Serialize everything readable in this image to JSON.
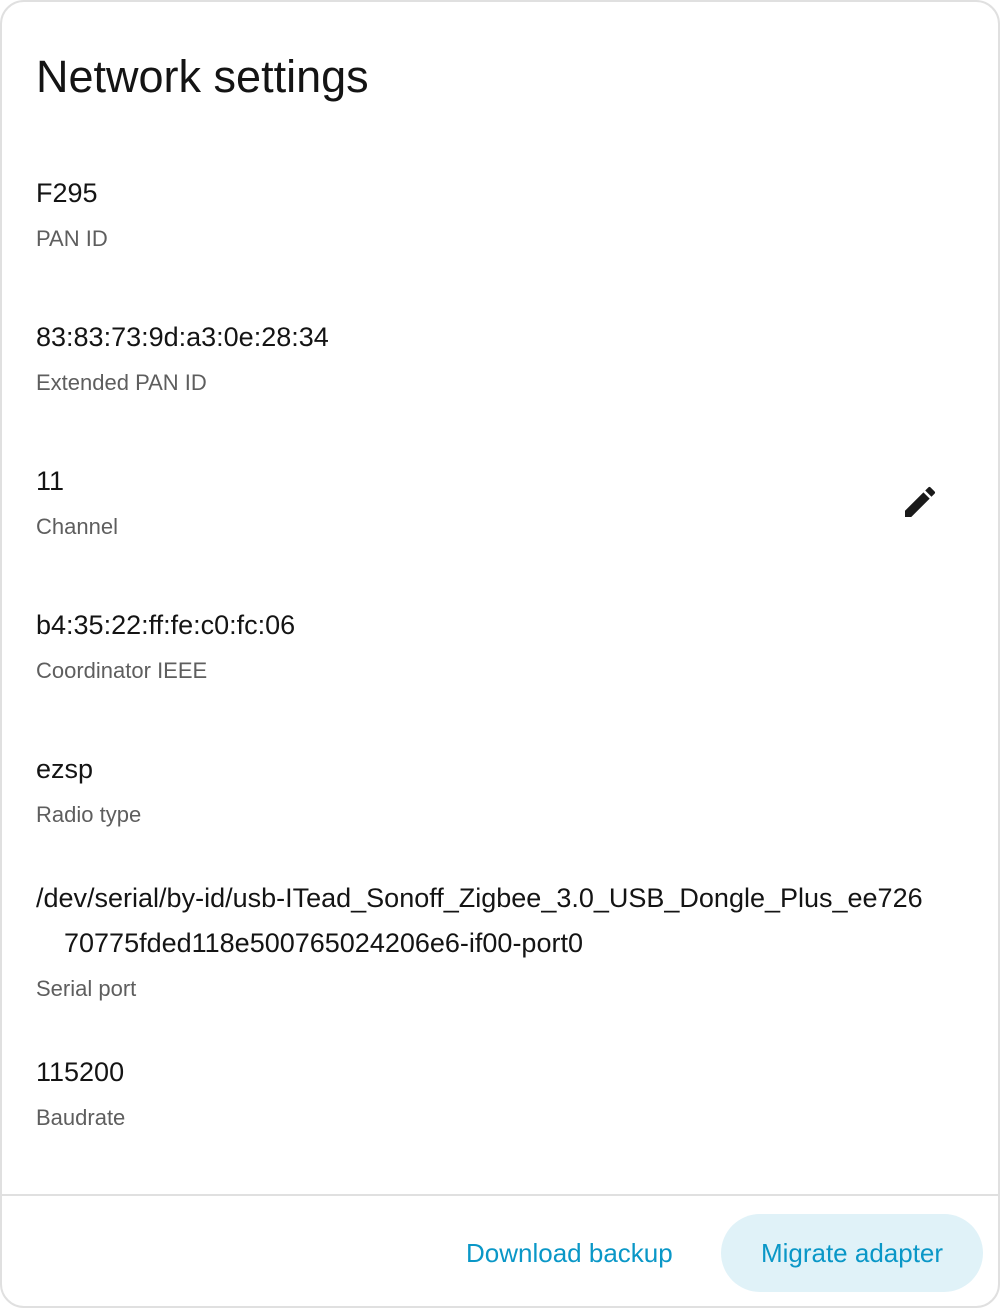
{
  "dialog": {
    "title": "Network settings"
  },
  "settings": [
    {
      "value": "F295",
      "label": "PAN ID"
    },
    {
      "value": "83:83:73:9d:a3:0e:28:34",
      "label": "Extended PAN ID"
    },
    {
      "value": "11",
      "label": "Channel"
    },
    {
      "value": "b4:35:22:ff:fe:c0:fc:06",
      "label": "Coordinator IEEE"
    },
    {
      "value": "ezsp",
      "label": "Radio type"
    },
    {
      "value": "/dev/serial/by-id/usb-ITead_Sonoff_Zigbee_3.0_USB_Dongle_Plus_ee72670775fded118e500765024206e6-if00-port0",
      "label": "Serial port"
    },
    {
      "value": "115200",
      "label": "Baudrate"
    }
  ],
  "channel_edit": {
    "icon": "pencil-icon"
  },
  "actions": {
    "download_label": "Download backup",
    "migrate_label": "Migrate adapter"
  },
  "colors": {
    "accent": "#0a97c7",
    "tonal_bg": "#e0f2f8"
  }
}
